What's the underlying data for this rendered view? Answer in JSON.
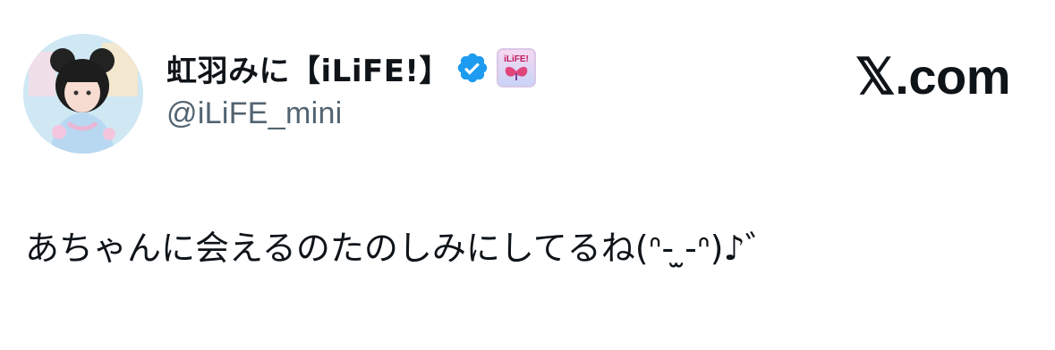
{
  "user": {
    "display_name": "虹羽みに【iLiFE!】",
    "handle": "@iLiFE_mini",
    "verified": true,
    "affiliate_badge_text": "iLiFE!"
  },
  "brand": {
    "label": "𝕏.com"
  },
  "tweet": {
    "text": "あちゃんに会えるのたのしみにしてるね(ᐢ- ̫-ᐢ)♪゛"
  },
  "colors": {
    "verified_blue": "#1d9bf0",
    "handle_gray": "#536471",
    "text_black": "#0f1419"
  },
  "icons": {
    "verified": "verified-badge-icon",
    "affiliate": "affiliate-badge-icon"
  }
}
